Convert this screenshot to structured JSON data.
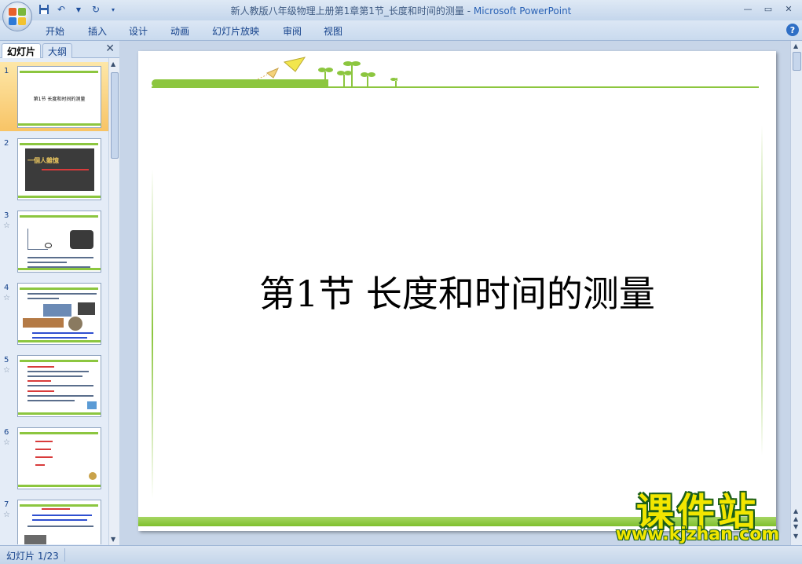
{
  "window": {
    "title": "新人教版八年级物理上册第1章第1节_长度和时间的测量",
    "title_sep": " - ",
    "app_name": "Microsoft PowerPoint"
  },
  "ribbon": {
    "tabs": [
      "开始",
      "插入",
      "设计",
      "动画",
      "幻灯片放映",
      "审阅",
      "视图"
    ]
  },
  "left_pane": {
    "tabs": {
      "slides": "幻灯片",
      "outline": "大纲"
    },
    "slides": [
      {
        "num": "1",
        "title": "第1节 长度和时间的测量"
      },
      {
        "num": "2",
        "caption": "一個人雜憶"
      },
      {
        "num": "3"
      },
      {
        "num": "4"
      },
      {
        "num": "5"
      },
      {
        "num": "6"
      },
      {
        "num": "7"
      }
    ]
  },
  "slide": {
    "title": "第1节 长度和时间的测量"
  },
  "status": {
    "slide_counter": "幻灯片 1/23"
  },
  "watermark": {
    "title": "课件站",
    "url": "www.kjzhan.com"
  },
  "colors": {
    "accent_green": "#8cc63f",
    "selected_thumb": "#f8c466",
    "watermark_yellow": "#f2e600",
    "watermark_outline": "#1c5f1a"
  }
}
